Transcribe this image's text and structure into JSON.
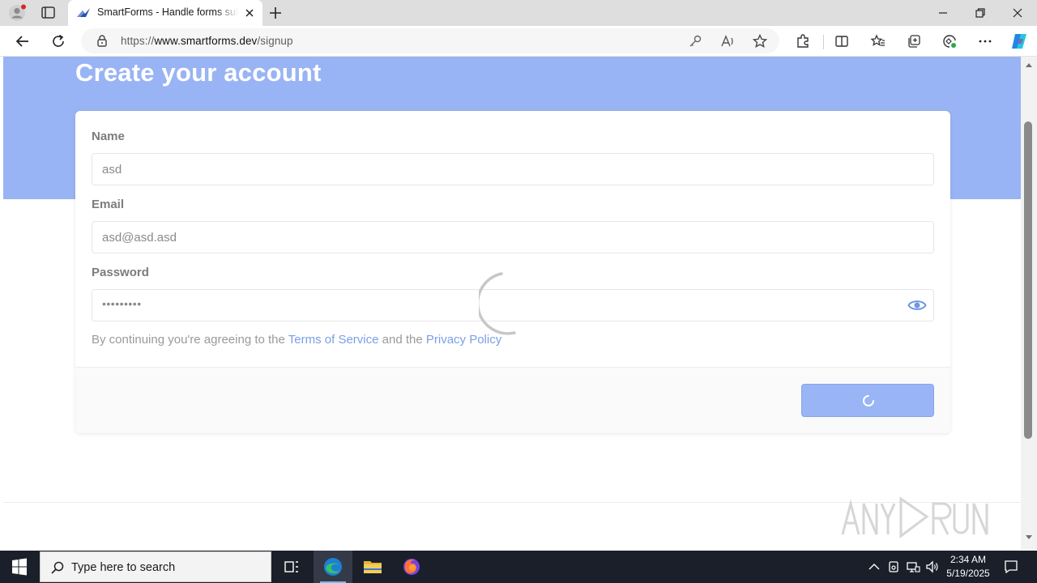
{
  "browser": {
    "tab_title": "SmartForms - Handle forms submissions",
    "url_prefix": "https://",
    "url_domain": "www.smartforms.dev",
    "url_path": "/signup"
  },
  "page": {
    "title": "Create your account",
    "form": {
      "name_label": "Name",
      "name_value": "asd",
      "email_label": "Email",
      "email_value": "asd@asd.asd",
      "password_label": "Password",
      "password_masked": "•••••••••",
      "terms_prefix": "By continuing you're agreeing to the ",
      "terms_link": "Terms of Service",
      "terms_middle": " and the ",
      "privacy_link": "Privacy Policy"
    },
    "submit_state": "loading",
    "colors": {
      "hero": "#99b4f4",
      "link": "#7aa0e6",
      "button": "#9ab5f5"
    }
  },
  "taskbar": {
    "search_placeholder": "Type here to search",
    "time": "2:34 AM",
    "date": "5/19/2025"
  },
  "watermark": "ANY RUN"
}
